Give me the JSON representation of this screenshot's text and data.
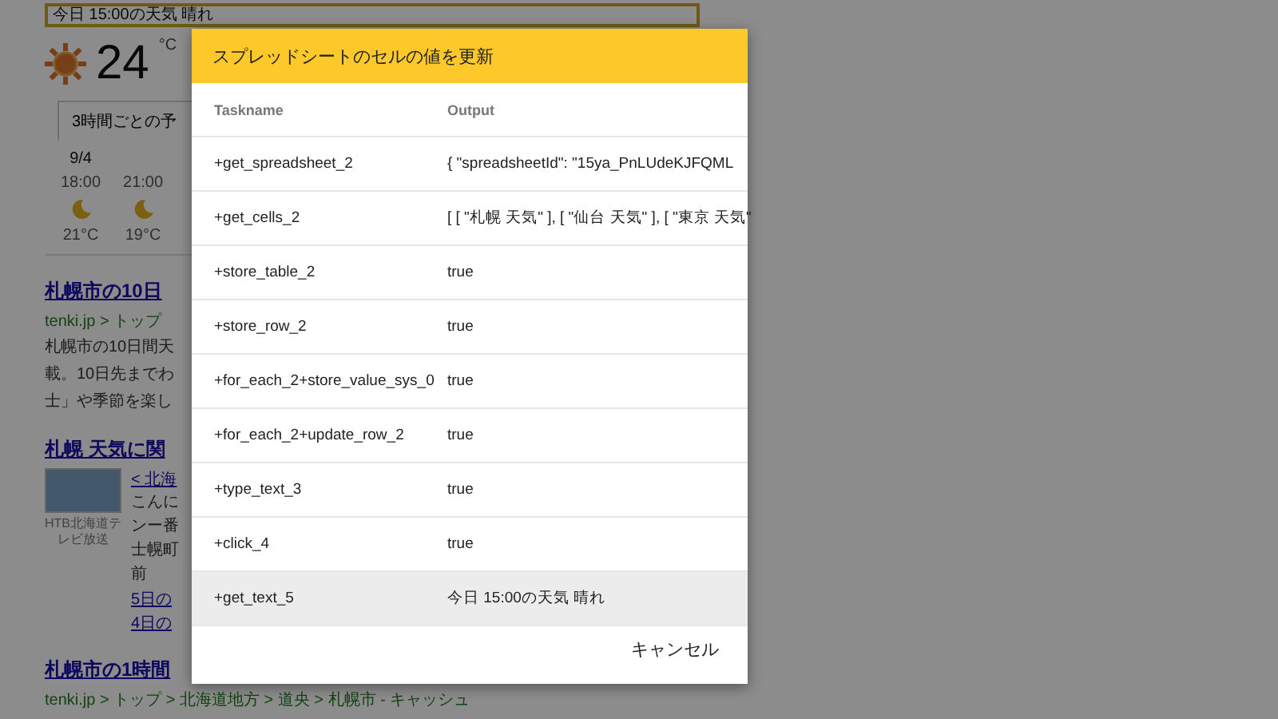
{
  "page": {
    "highlight": "今日 15:00の天気 晴れ",
    "temperature": "24",
    "unit": "°C",
    "forecast_tab": "3時間ごとの予",
    "forecast": [
      {
        "date": "9/4",
        "time": "18:00",
        "temp": "21°C"
      },
      {
        "time": "21:00",
        "temp": "19°C"
      }
    ],
    "results": [
      {
        "kind": "text",
        "title": "札幌市の10日",
        "breadcrumb": "tenki.jp > トップ",
        "snippet": [
          "札幌市の10日間天",
          "載。10日先までわ",
          "士」や季節を楽し"
        ]
      },
      {
        "kind": "video",
        "title": "札幌 天気に関",
        "caption": "HTB北海道テレビ放送",
        "lines": [
          "< 北海",
          "こんに",
          "ンー番",
          "士幌町",
          "前"
        ],
        "links": [
          "5日の",
          "4日の"
        ]
      },
      {
        "kind": "text",
        "title": "札幌市の1時間",
        "breadcrumb": "tenki.jp > トップ > 北海道地方 > 道央 > 札幌市 - キャッシュ"
      }
    ]
  },
  "dialog": {
    "title": "スプレッドシートのセルの値を更新",
    "columns": [
      "Taskname",
      "Output"
    ],
    "rows": [
      {
        "task": "+get_spreadsheet_2",
        "output": "{ \"spreadsheetId\": \"15ya_PnLUdeKJFQML",
        "selected": false
      },
      {
        "task": "+get_cells_2",
        "output": "[ [ \"札幌 天気\" ], [ \"仙台 天気\" ], [ \"東京 天気\"",
        "selected": false
      },
      {
        "task": "+store_table_2",
        "output": "true",
        "selected": false
      },
      {
        "task": "+store_row_2",
        "output": "true",
        "selected": false
      },
      {
        "task": "+for_each_2+store_value_sys_0",
        "output": "true",
        "selected": false
      },
      {
        "task": "+for_each_2+update_row_2",
        "output": "true",
        "selected": false
      },
      {
        "task": "+type_text_3",
        "output": "true",
        "selected": false
      },
      {
        "task": "+click_4",
        "output": "true",
        "selected": false
      },
      {
        "task": "+get_text_5",
        "output": "今日 15:00の天気 晴れ",
        "selected": true
      }
    ],
    "cancel": "キャンセル"
  }
}
